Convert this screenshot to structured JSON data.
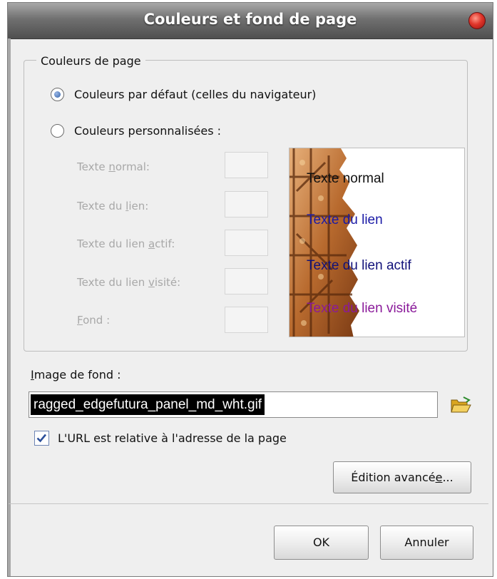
{
  "window": {
    "title": "Couleurs et fond de page"
  },
  "page_colors": {
    "legend": "Couleurs de page",
    "default_option": "Couleurs par défaut (celles du navigateur)",
    "custom_option": "Couleurs personnalisées :",
    "selected": "default",
    "labels": {
      "normal": {
        "before": "Texte ",
        "key": "n",
        "after": "ormal:"
      },
      "link": {
        "before": "Texte du ",
        "key": "l",
        "after": "ien:"
      },
      "active": {
        "before": "Texte du lien ",
        "key": "a",
        "after": "ctif:"
      },
      "visited": {
        "before": "Texte du lien ",
        "key": "v",
        "after": "isité:"
      },
      "background": {
        "before": "",
        "key": "F",
        "after": "ond :"
      }
    }
  },
  "preview": {
    "normal": "Texte normal",
    "link": "Texte du lien",
    "active": "Texte du lien actif",
    "visited": "Texte du lien visité",
    "colors": {
      "normal": "#111111",
      "link": "#1a1aa6",
      "active": "#11117a",
      "visited": "#8a1a9a"
    }
  },
  "background_image": {
    "label_key": "I",
    "label_rest": "mage de fond :",
    "value": "ragged_edgefutura_panel_md_wht.gif",
    "browse_icon": "folder-open-icon"
  },
  "relative_url": {
    "label": "L'URL est relative à l'adresse de la page",
    "checked": true
  },
  "buttons": {
    "advanced_before": "Édition avancé",
    "advanced_key": "e",
    "advanced_after": "...",
    "ok": "OK",
    "cancel": "Annuler"
  }
}
